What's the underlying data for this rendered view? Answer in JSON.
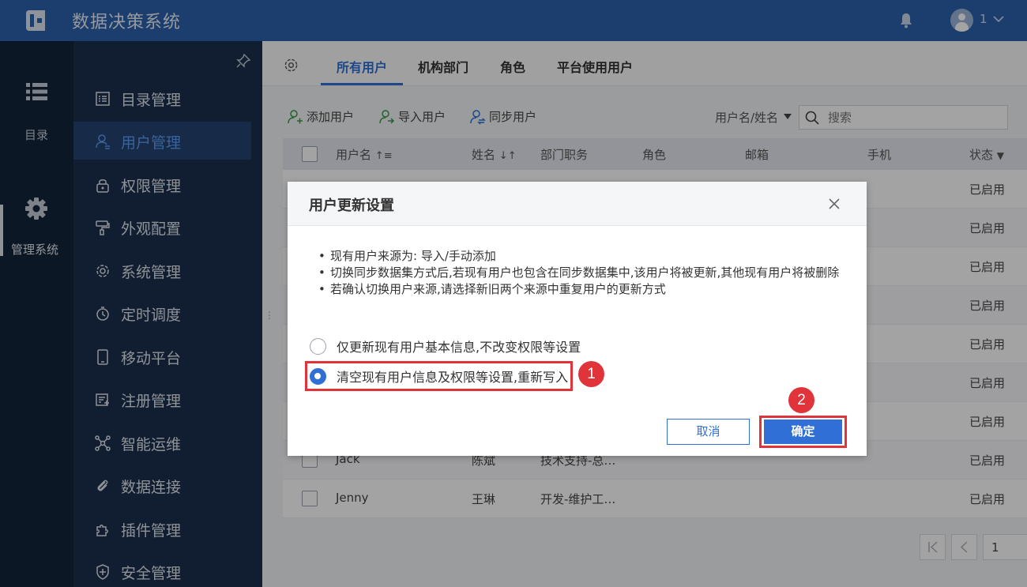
{
  "app": {
    "title": "数据决策系统",
    "user": "1"
  },
  "leftnav": {
    "catalog_label": "目录",
    "admin_label": "管理系统"
  },
  "sidebar": {
    "items": [
      {
        "label": "目录管理"
      },
      {
        "label": "用户管理"
      },
      {
        "label": "权限管理"
      },
      {
        "label": "外观配置"
      },
      {
        "label": "系统管理"
      },
      {
        "label": "定时调度"
      },
      {
        "label": "移动平台"
      },
      {
        "label": "注册管理"
      },
      {
        "label": "智能运维"
      },
      {
        "label": "数据连接"
      },
      {
        "label": "插件管理"
      },
      {
        "label": "安全管理"
      }
    ],
    "active_index": 1
  },
  "tabs": [
    {
      "label": "所有用户"
    },
    {
      "label": "机构部门"
    },
    {
      "label": "角色"
    },
    {
      "label": "平台使用用户"
    }
  ],
  "toolbar": {
    "add_user": "添加用户",
    "import_user": "导入用户",
    "sync_user": "同步用户",
    "filter_label": "用户名/姓名",
    "search_placeholder": "搜索"
  },
  "table": {
    "columns": [
      "用户名",
      "姓名",
      "部门职务",
      "角色",
      "邮箱",
      "手机",
      "状态"
    ],
    "rows": [
      {
        "username": "",
        "name": "",
        "dept": "",
        "status": "已启用"
      },
      {
        "username": "",
        "name": "",
        "dept": "",
        "status": "已启用"
      },
      {
        "username": "",
        "name": "",
        "dept": "",
        "status": "已启用"
      },
      {
        "username": "",
        "name": "",
        "dept": "",
        "status": "已启用"
      },
      {
        "username": "",
        "name": "",
        "dept": "",
        "status": "已启用"
      },
      {
        "username": "",
        "name": "",
        "dept": "",
        "status": "已启用"
      },
      {
        "username": "",
        "name": "",
        "dept": "",
        "status": "已启用"
      },
      {
        "username": "Jack",
        "name": "陈斌",
        "dept": "技术支持-总…",
        "status": "已启用"
      },
      {
        "username": "Jenny",
        "name": "王琳",
        "dept": "开发-维护工…",
        "status": "已启用"
      }
    ]
  },
  "pager": {
    "page": "1"
  },
  "dialog": {
    "title": "用户更新设置",
    "bullets": [
      "现有用户来源为: 导入/手动添加",
      "切换同步数据集方式后,若现有用户也包含在同步数据集中,该用户将被更新,其他现有用户将被删除",
      "若确认切换用户来源,请选择新旧两个来源中重复用户的更新方式"
    ],
    "option1": "仅更新现有用户基本信息,不改变权限等设置",
    "option2": "清空现有用户信息及权限等设置,重新写入",
    "selected_option": 2,
    "cancel": "取消",
    "ok": "确定"
  },
  "annotations": {
    "badge1": "1",
    "badge2": "2",
    "color": "#e0333a"
  },
  "colors": {
    "topbar": "#2d62ad",
    "accent": "#2f6fd6",
    "sidebar": "#1c2f4d",
    "leftnav": "#14243b"
  }
}
